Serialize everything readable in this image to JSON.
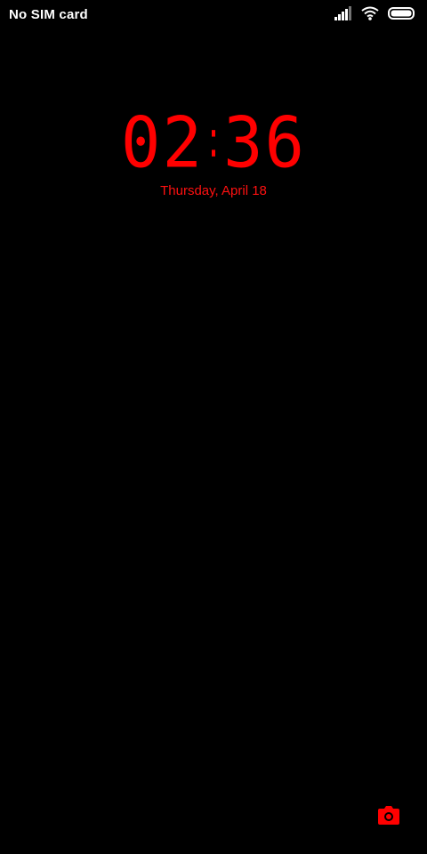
{
  "status_bar": {
    "carrier": "No SIM card",
    "icons": [
      "signal-icon",
      "wifi-icon",
      "battery-icon"
    ]
  },
  "lockscreen": {
    "clock": {
      "hours": "02",
      "minutes": "36"
    },
    "date": "Thursday, April 18",
    "accent_color": "#ff0000"
  },
  "shortcuts": {
    "camera_icon": "camera-icon"
  }
}
